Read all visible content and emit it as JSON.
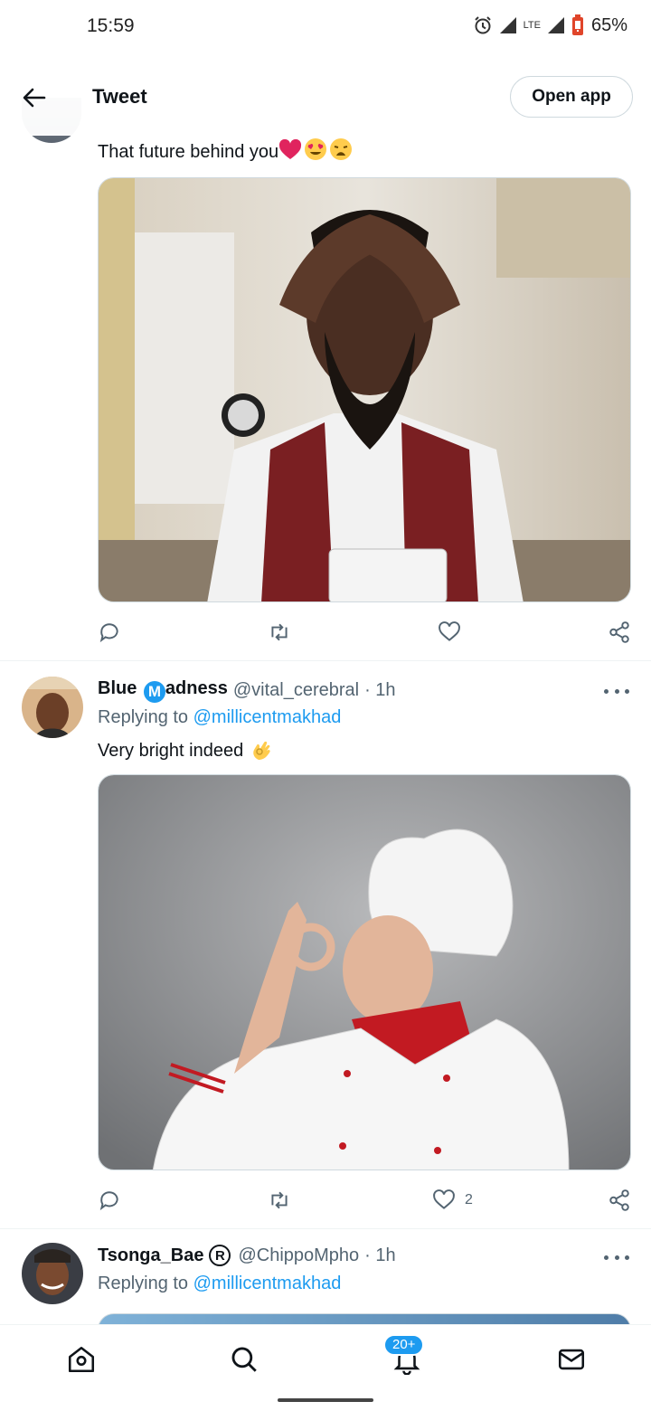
{
  "status_bar": {
    "time": "15:59",
    "network": "LTE",
    "battery": "65%"
  },
  "header": {
    "title": "Tweet",
    "open_app_label": "Open app"
  },
  "tweets": [
    {
      "text": "That future behind you",
      "emojis": [
        "red-heart",
        "heart-eyes",
        "weary-face"
      ],
      "media": "man with beard, hands on head, wearing watch and red vest",
      "actions": {
        "like_count": ""
      }
    },
    {
      "display_name_first": "Blue",
      "display_name_letter": "M",
      "display_name_rest": "adness",
      "handle": "@vital_cerebral",
      "time": "· 1h",
      "replying_prefix": "Replying to",
      "replying_to": "@millicentmakhad",
      "text": "Very bright indeed",
      "emojis": [
        "ok-hand"
      ],
      "media": "chef in white hat making perfect gesture",
      "actions": {
        "like_count": "2"
      }
    },
    {
      "display_name": "Tsonga_Bae",
      "name_badge": "R",
      "handle": "@ChippoMpho",
      "time": "· 1h",
      "replying_prefix": "Replying to",
      "replying_to": "@millicentmakhad"
    }
  ],
  "bottom_nav": {
    "notification_badge": "20+"
  },
  "colors": {
    "accent": "#1d9bf0",
    "text": "#0f1419",
    "secondary": "#536471",
    "border": "#cfd9de"
  }
}
